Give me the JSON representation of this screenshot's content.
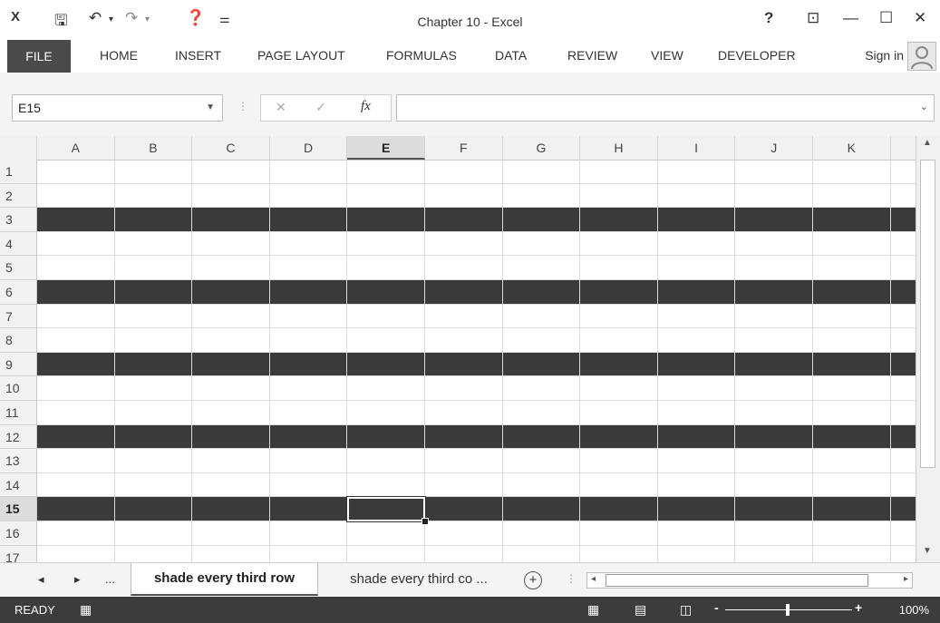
{
  "window": {
    "title": "Chapter 10 - Excel",
    "help": "?",
    "restore_ribbon": "⊡",
    "minimize": "—",
    "maximize": "☐",
    "close": "✕"
  },
  "quick_access": {
    "save": "🖫",
    "undo": "↶",
    "undo_more": "▾",
    "redo": "↷",
    "redo_more": "▾",
    "help": "❓",
    "customize": "⚌"
  },
  "ribbon": {
    "tabs": [
      "FILE",
      "HOME",
      "INSERT",
      "PAGE LAYOUT",
      "FORMULAS",
      "DATA",
      "REVIEW",
      "VIEW",
      "DEVELOPER"
    ],
    "sign_in": "Sign in"
  },
  "formula_bar": {
    "name_box": "E15",
    "cancel": "✕",
    "enter": "✓",
    "fx": "fx",
    "formula": ""
  },
  "grid": {
    "columns": [
      "A",
      "B",
      "C",
      "D",
      "E",
      "F",
      "G",
      "H",
      "I",
      "J",
      "K"
    ],
    "rows": [
      "1",
      "2",
      "3",
      "4",
      "5",
      "6",
      "7",
      "8",
      "9",
      "10",
      "11",
      "12",
      "13",
      "14",
      "15",
      "16",
      "17"
    ],
    "shaded_rows": [
      3,
      6,
      9,
      12,
      15
    ],
    "active_column": "E",
    "active_row": "15"
  },
  "sheets": {
    "prev": "◂",
    "next": "▸",
    "more": "...",
    "tabs": [
      "shade every third row",
      "shade every third co ..."
    ],
    "active": "shade every third row",
    "add": "+"
  },
  "status": {
    "text": "READY",
    "zoom": "100%",
    "zoom_minus": "-",
    "zoom_plus": "+"
  },
  "colors": {
    "shade": "#3a3a3a",
    "status_bar": "#3c3c3c"
  }
}
